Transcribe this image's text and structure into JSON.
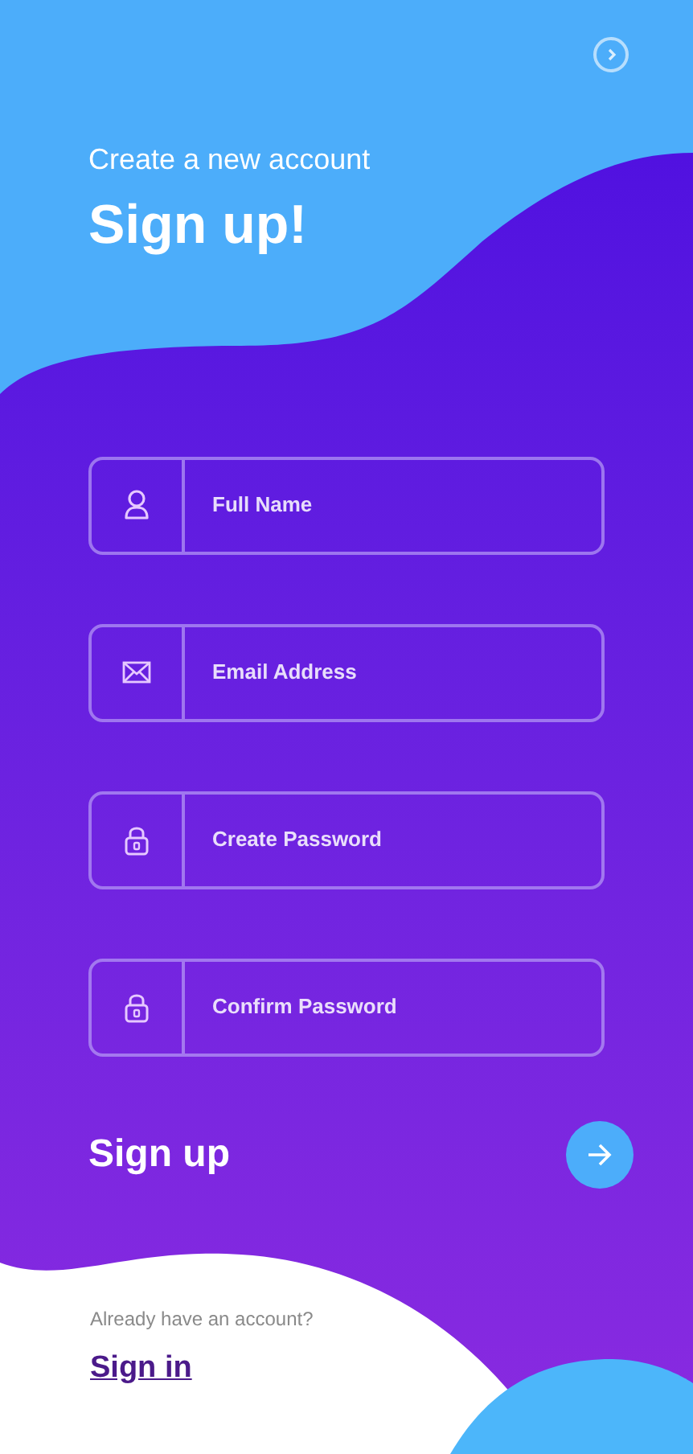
{
  "header": {
    "subtitle": "Create a new account",
    "title": "Sign up!"
  },
  "fields": [
    {
      "kind": "person",
      "placeholder": "Full Name"
    },
    {
      "kind": "mail",
      "placeholder": "Email Address"
    },
    {
      "kind": "lock",
      "placeholder": "Create Password"
    },
    {
      "kind": "lock",
      "placeholder": "Confirm Password"
    }
  ],
  "submit": {
    "label": "Sign up"
  },
  "footer": {
    "prompt": "Already have an account?",
    "link": "Sign in"
  }
}
